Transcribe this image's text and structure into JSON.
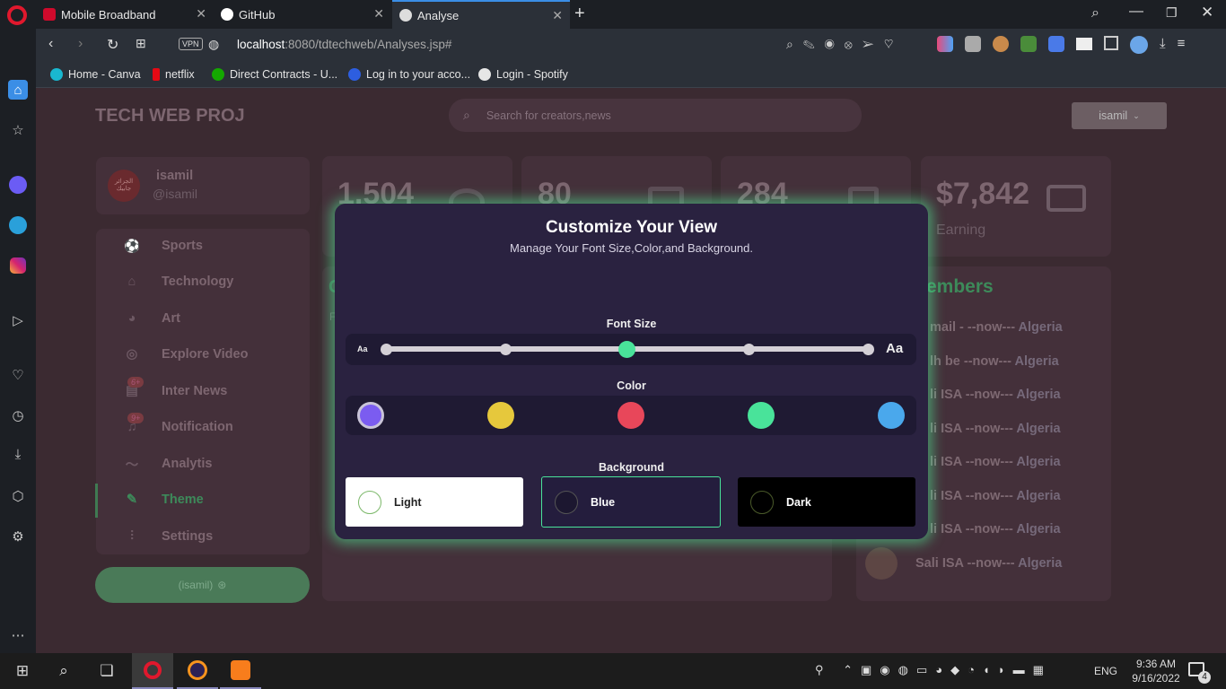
{
  "browser": {
    "tabs": [
      {
        "title": "Mobile Broadband",
        "favicon": "huawei-icon"
      },
      {
        "title": "GitHub",
        "favicon": "github-icon"
      },
      {
        "title": "Analyse",
        "favicon": "globe-icon",
        "active": true
      }
    ],
    "address": {
      "host": "localhost",
      "path": ":8080/tdtechweb/Analyses.jsp#"
    },
    "vpn_label": "VPN",
    "bookmarks": [
      {
        "label": "Home - Canva",
        "color": "#19b8d0"
      },
      {
        "label": "netflix",
        "color": "#e50914"
      },
      {
        "label": "Direct Contracts - U...",
        "color": "#14a800"
      },
      {
        "label": "Log in to your acco...",
        "color": "#0033a0"
      },
      {
        "label": "Login - Spotify",
        "color": "#e6e6e6"
      }
    ]
  },
  "app": {
    "brand": "TECH WEB PROJ",
    "search_placeholder": "Search for creators,news",
    "user_button": "isamil",
    "profile": {
      "name": "isamil",
      "handle": "@isamil",
      "avatar_text": "الجزائر\nجابيك"
    },
    "nav": [
      {
        "label": "Sports",
        "icon": "soccer-icon"
      },
      {
        "label": "Technology",
        "icon": "robot-icon"
      },
      {
        "label": "Art",
        "icon": "palette-icon"
      },
      {
        "label": "Explore Video",
        "icon": "compass-icon"
      },
      {
        "label": "Inter News",
        "icon": "news-icon",
        "badge": "6+"
      },
      {
        "label": "Notification",
        "icon": "bell-icon",
        "badge": "9+"
      },
      {
        "label": "Analytis",
        "icon": "chart-icon"
      },
      {
        "label": "Theme",
        "icon": "brush-icon",
        "active": true
      },
      {
        "label": "Settings",
        "icon": "sliders-icon"
      }
    ],
    "logout_label": "(isamil)",
    "stats": [
      {
        "value": "1,504",
        "label": ""
      },
      {
        "value": "80",
        "label": ""
      },
      {
        "value": "284",
        "label": ""
      },
      {
        "value": "$7,842",
        "label": "Earning"
      }
    ],
    "members_title": "embers",
    "members": [
      {
        "name": "mail - --now---",
        "country": "Algeria"
      },
      {
        "name": "lh be --now---",
        "country": "Algeria"
      },
      {
        "name": "li ISA --now---",
        "country": "Algeria"
      },
      {
        "name": "li ISA --now---",
        "country": "Algeria"
      },
      {
        "name": "li ISA --now---",
        "country": "Algeria"
      },
      {
        "name": "li ISA --now---",
        "country": "Algeria"
      },
      {
        "name": "li ISA --now---",
        "country": "Algeria"
      },
      {
        "name": "Sali ISA --now---",
        "country": "Algeria"
      }
    ],
    "left_stub_1": "C",
    "left_stub_2": "F"
  },
  "modal": {
    "title": "Customize Your View",
    "subtitle": "Manage Your Font Size,Color,and Background.",
    "font_size": {
      "label": "Font Size",
      "small": "Aa",
      "large": "Aa",
      "steps": 5,
      "selected_index": 2
    },
    "color": {
      "label": "Color",
      "swatches": [
        "#7b5cf0",
        "#e6c83c",
        "#e8475a",
        "#49e39a",
        "#4aa8ec"
      ],
      "selected_index": 0
    },
    "background": {
      "label": "Background",
      "options": [
        {
          "label": "Light",
          "bg": "#ffffff",
          "fg": "#222"
        },
        {
          "label": "Blue",
          "bg": "#241d3d",
          "fg": "#ffffff",
          "selected": true
        },
        {
          "label": "Dark",
          "bg": "#000000",
          "fg": "#ffffff"
        }
      ]
    },
    "accent": "#49e39a"
  },
  "taskbar": {
    "lang": "ENG",
    "time": "9:36 AM",
    "date": "9/16/2022",
    "notif_count": "4"
  }
}
